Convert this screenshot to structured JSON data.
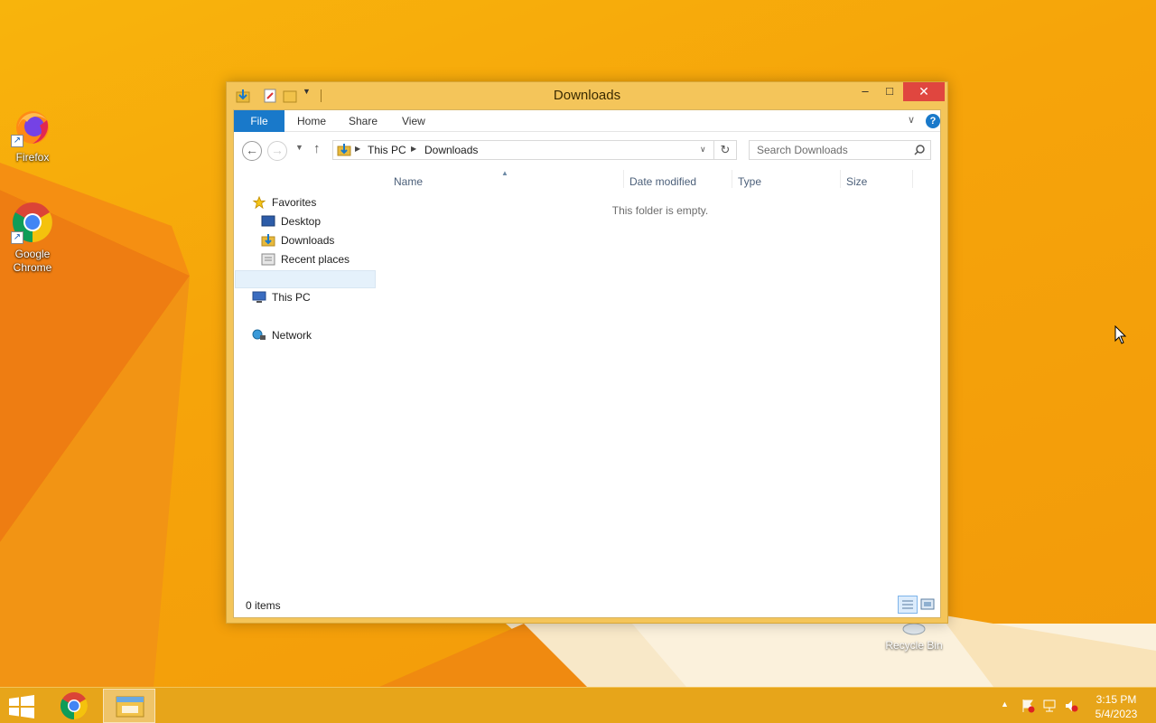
{
  "desktop": {
    "icons": [
      {
        "label": "Firefox",
        "icon": "firefox-icon"
      },
      {
        "label": "Google Chrome",
        "icon": "chrome-icon"
      }
    ],
    "recycle_bin_label": "Recycle Bin"
  },
  "window": {
    "title": "Downloads",
    "controls": {
      "minimize": "–",
      "maximize": "□",
      "close": "✕"
    },
    "ribbon": {
      "tabs": [
        "File",
        "Home",
        "Share",
        "View"
      ],
      "help": "?"
    },
    "address": {
      "crumbs": [
        "This PC",
        "Downloads"
      ]
    },
    "search": {
      "placeholder": "Search Downloads"
    },
    "nav_pane": {
      "favorites": "Favorites",
      "desktop": "Desktop",
      "downloads": "Downloads",
      "recent_places": "Recent places",
      "this_pc": "This PC",
      "network": "Network"
    },
    "columns": [
      "Name",
      "Date modified",
      "Type",
      "Size"
    ],
    "empty_message": "This folder is empty.",
    "status": {
      "item_count": "0 items"
    }
  },
  "taskbar": {
    "clock_time": "3:15 PM",
    "clock_date": "5/4/2023"
  },
  "colors": {
    "wallpaper": "#f6a40a",
    "window_frame": "#f4c55a",
    "file_tab": "#1979ca",
    "close_button": "#e0463f"
  }
}
